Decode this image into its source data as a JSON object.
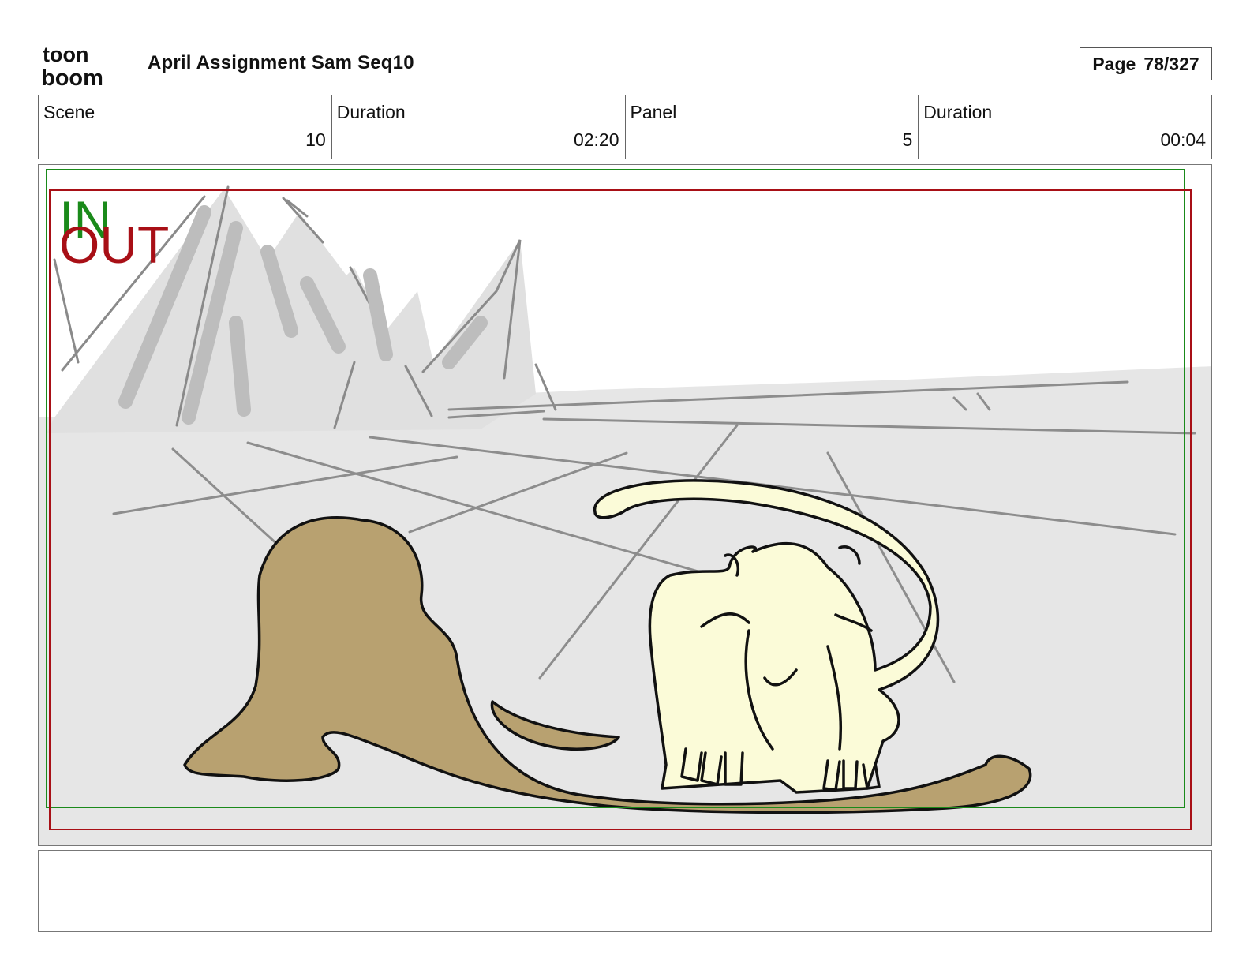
{
  "header": {
    "logo_text_top": "toon",
    "logo_text_bottom": "boom",
    "title": "April Assignment Sam Seq10",
    "page_label": "Page",
    "page_value": "78/327"
  },
  "info": {
    "scene_label": "Scene",
    "scene_value": "10",
    "scene_duration_label": "Duration",
    "scene_duration_value": "02:20",
    "panel_label": "Panel",
    "panel_value": "5",
    "panel_duration_label": "Duration",
    "panel_duration_value": "00:04"
  },
  "panel": {
    "in_marker": "IN",
    "out_marker": "OUT",
    "colors": {
      "in": "#1a8a1a",
      "out": "#a80f16",
      "ground": "#e6e6e6",
      "shadow": "#b8a170",
      "creature": "#fbfbd8"
    }
  },
  "notes": {
    "text": ""
  }
}
